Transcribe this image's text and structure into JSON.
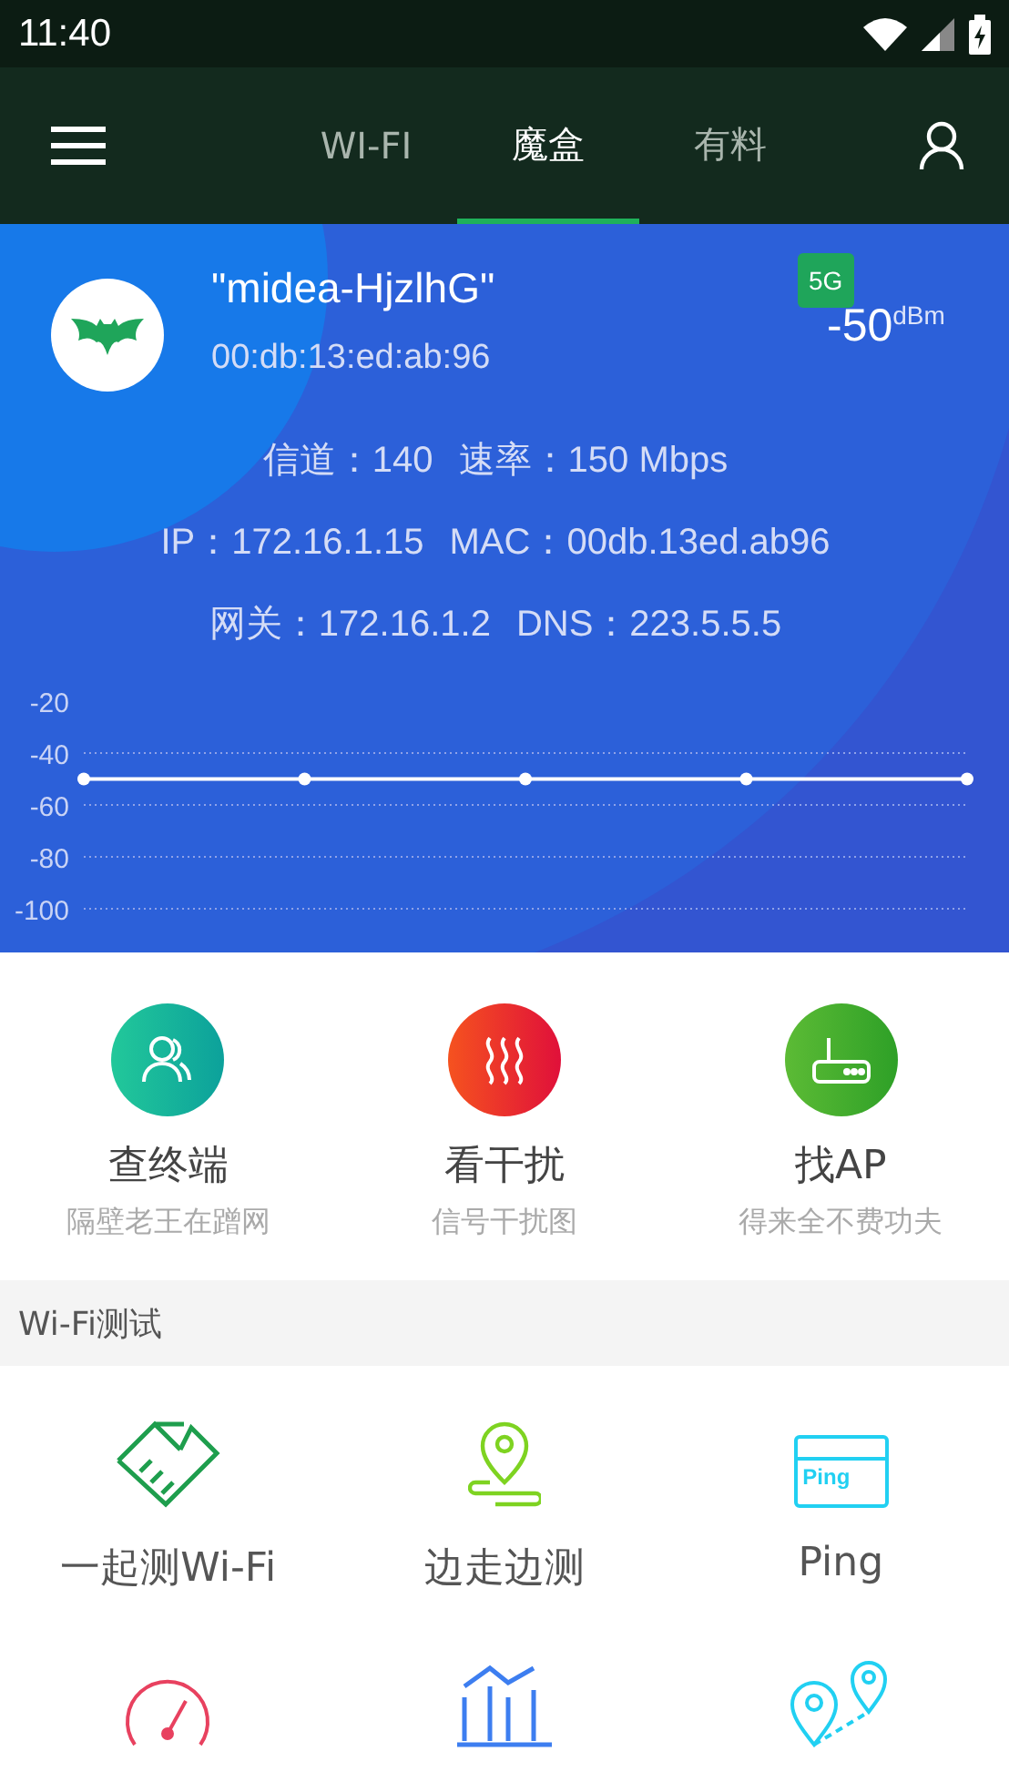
{
  "status_bar": {
    "time": "11:40"
  },
  "tabs": [
    {
      "label": "WI-FI",
      "selected": false
    },
    {
      "label": "魔盒",
      "selected": true
    },
    {
      "label": "有料",
      "selected": false
    }
  ],
  "network": {
    "ssid": "\"midea-HjzlhG\"",
    "bssid": "00:db:13:ed:ab:96",
    "band": "5G",
    "signal": "-50",
    "signal_unit": "dBm",
    "details": [
      [
        {
          "label": "信道：",
          "value": "140"
        },
        {
          "label": "速率：",
          "value": "150 Mbps"
        }
      ],
      [
        {
          "label": "IP：",
          "value": "172.16.1.15"
        },
        {
          "label": "MAC：",
          "value": "00db.13ed.ab96"
        }
      ],
      [
        {
          "label": "网关：",
          "value": "172.16.1.2"
        },
        {
          "label": "DNS：",
          "value": "223.5.5.5"
        }
      ]
    ],
    "chart_data": {
      "type": "line",
      "values": [
        -50,
        -50,
        -50,
        -50,
        -50
      ],
      "ylim": [
        -100,
        -20
      ],
      "yticks": [
        -20,
        -40,
        -60,
        -80,
        -100
      ],
      "grid": true
    }
  },
  "features": [
    {
      "kind": "devices",
      "title": "查终端",
      "subtitle": "隔壁老王在蹭网"
    },
    {
      "kind": "interference",
      "title": "看干扰",
      "subtitle": "信号干扰图"
    },
    {
      "kind": "router",
      "title": "找AP",
      "subtitle": "得来全不费功夫"
    }
  ],
  "section": {
    "title": "Wi-Fi测试"
  },
  "tests": [
    {
      "kind": "handshake",
      "label": "一起测Wi-Fi"
    },
    {
      "kind": "walk",
      "label": "边走边测"
    },
    {
      "kind": "ping",
      "label": "Ping",
      "icon_text": "Ping"
    },
    {
      "kind": "speed"
    },
    {
      "kind": "channel"
    },
    {
      "kind": "roam"
    }
  ]
}
